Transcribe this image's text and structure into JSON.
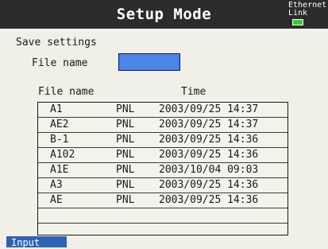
{
  "header": {
    "title": "Setup Mode",
    "ethernet_line1": "Ethernet",
    "ethernet_line2": "Link"
  },
  "save": {
    "section_label": "Save settings",
    "file_name_label": "File name",
    "file_name_value": ""
  },
  "file_list": {
    "columns": {
      "name": "File name",
      "time": "Time"
    },
    "rows": [
      {
        "name": "A1",
        "type": "PNL",
        "time": "2003/09/25 14:37"
      },
      {
        "name": "AE2",
        "type": "PNL",
        "time": "2003/09/25 14:37"
      },
      {
        "name": "B-1",
        "type": "PNL",
        "time": "2003/09/25 14:36"
      },
      {
        "name": "A102",
        "type": "PNL",
        "time": "2003/09/25 14:36"
      },
      {
        "name": "A1E",
        "type": "PNL",
        "time": "2003/10/04 09:03"
      },
      {
        "name": "A3",
        "type": "PNL",
        "time": "2003/09/25 14:36"
      },
      {
        "name": "AE",
        "type": "PNL",
        "time": "2003/09/25 14:36"
      }
    ]
  },
  "softkeys": {
    "input_label": "Input"
  },
  "colors": {
    "title_bar": "#2b2b2b",
    "input_field": "#4a86e8",
    "link_led": "#2fd12f",
    "softkey": "#2e63b6"
  }
}
